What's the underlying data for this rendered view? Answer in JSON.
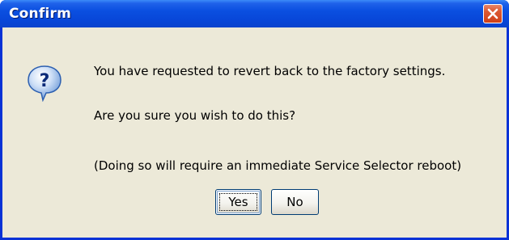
{
  "window": {
    "title": "Confirm",
    "close_icon": "close-icon"
  },
  "dialog": {
    "icon": "question-icon",
    "messages": [
      "You have requested to revert back to the factory settings.",
      "Are you sure you wish to do this?",
      "(Doing so will require an immediate Service Selector reboot)"
    ]
  },
  "buttons": {
    "yes_label": "Yes",
    "no_label": "No",
    "default": "Yes"
  },
  "colors": {
    "titlebar": "#0a4fe0",
    "frame": "#0832d6",
    "body": "#ece9d8",
    "close_button": "#d4542f"
  }
}
